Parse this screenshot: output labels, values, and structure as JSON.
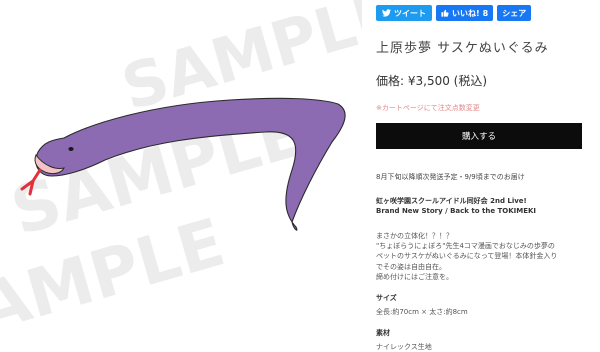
{
  "image": {
    "watermark": "SAMPLE"
  },
  "share": {
    "tweet_label": "ツイート",
    "like_label": "いいね!",
    "like_count": "8",
    "share_label": "シェア"
  },
  "product": {
    "title": "上原歩夢 サスケぬいぐるみ",
    "price_label": "価格:",
    "price_value": "¥3,500 (税込)",
    "cart_note": "※カートページにて注文点数変更",
    "buy_label": "購入する",
    "shipping_note": "8月下旬以降順次発送予定・9/9頃までのお届け",
    "event_line1": "虹ヶ咲学園スクールアイドル同好会 2nd Live!",
    "event_line2": "Brand New Story / Back to the TOKIMEKI",
    "description": [
      "まさかの立体化！？！？",
      "\"ちょぼらうにょぼろ\"先生4コマ漫画でおなじみの歩夢の",
      "ペットのサスケがぬいぐるみになって登場！本体針金入り",
      "でその姿は自由自在。",
      "締め付けにはご注意を。"
    ],
    "size_label": "サイズ",
    "size_value": "全長:約70cm × 太さ:約8cm",
    "material_label": "素材",
    "material_value": "ナイレックス生地"
  },
  "colors": {
    "snake_body": "#8d6bb3",
    "snake_outline": "#2a2a2a",
    "snake_mouth": "#f3c3c5",
    "snake_tongue": "#e2303d",
    "watermark": "#ececec",
    "buy_button": "#0c0c0c",
    "tweet_button": "#1d9bf0",
    "facebook_button": "#1877f2",
    "cart_note": "#e08a8a"
  }
}
